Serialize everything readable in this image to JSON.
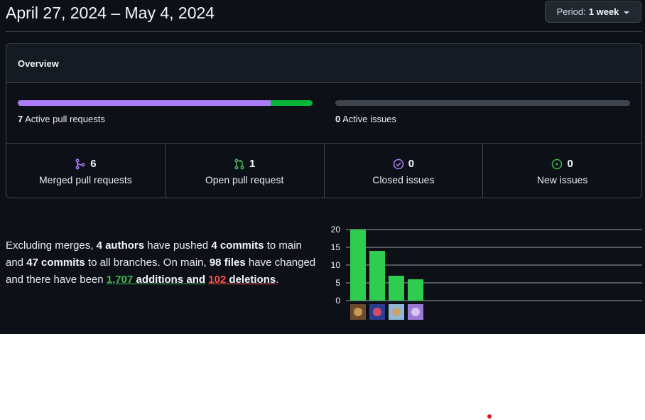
{
  "header": {
    "date_range": "April 27, 2024 – May 4, 2024",
    "period_label": "Period:",
    "period_value": "1 week"
  },
  "overview": {
    "title": "Overview",
    "pull_requests": {
      "count": "7",
      "label": "Active pull requests",
      "merged_fraction": 0.857,
      "open_fraction": 0.143
    },
    "issues": {
      "count": "0",
      "label": "Active issues"
    },
    "stats": [
      {
        "value": "6",
        "label": "Merged pull requests",
        "icon": "git-merge-icon",
        "color": "#ab7df8"
      },
      {
        "value": "1",
        "label": "Open pull request",
        "icon": "git-pull-request-icon",
        "color": "#3fb950"
      },
      {
        "value": "0",
        "label": "Closed issues",
        "icon": "issue-closed-icon",
        "color": "#ab7df8"
      },
      {
        "value": "0",
        "label": "New issues",
        "icon": "issue-opened-icon",
        "color": "#3fb950"
      }
    ]
  },
  "summary": {
    "t1": "Excluding merges, ",
    "authors": "4 authors",
    "t2": " have pushed ",
    "commits_main": "4 commits",
    "t3": " to main and ",
    "commits_all": "47 commits",
    "t4": " to all branches. On main, ",
    "files": "98 files",
    "t5": " have changed and there have been ",
    "additions_num": "1,707",
    "additions_word": " additions",
    "and_word": " and",
    "deletions_num": "102",
    "deletions_word": " deletions",
    "t6": "."
  },
  "chart_data": {
    "type": "bar",
    "categories": [
      "author-1",
      "author-2",
      "author-3",
      "author-4"
    ],
    "values": [
      20,
      14,
      7,
      6
    ],
    "ylim": [
      0,
      20
    ],
    "yticks": [
      "0",
      "5",
      "10",
      "15",
      "20"
    ],
    "bar_color": "#2ecc4f",
    "grid": true
  }
}
